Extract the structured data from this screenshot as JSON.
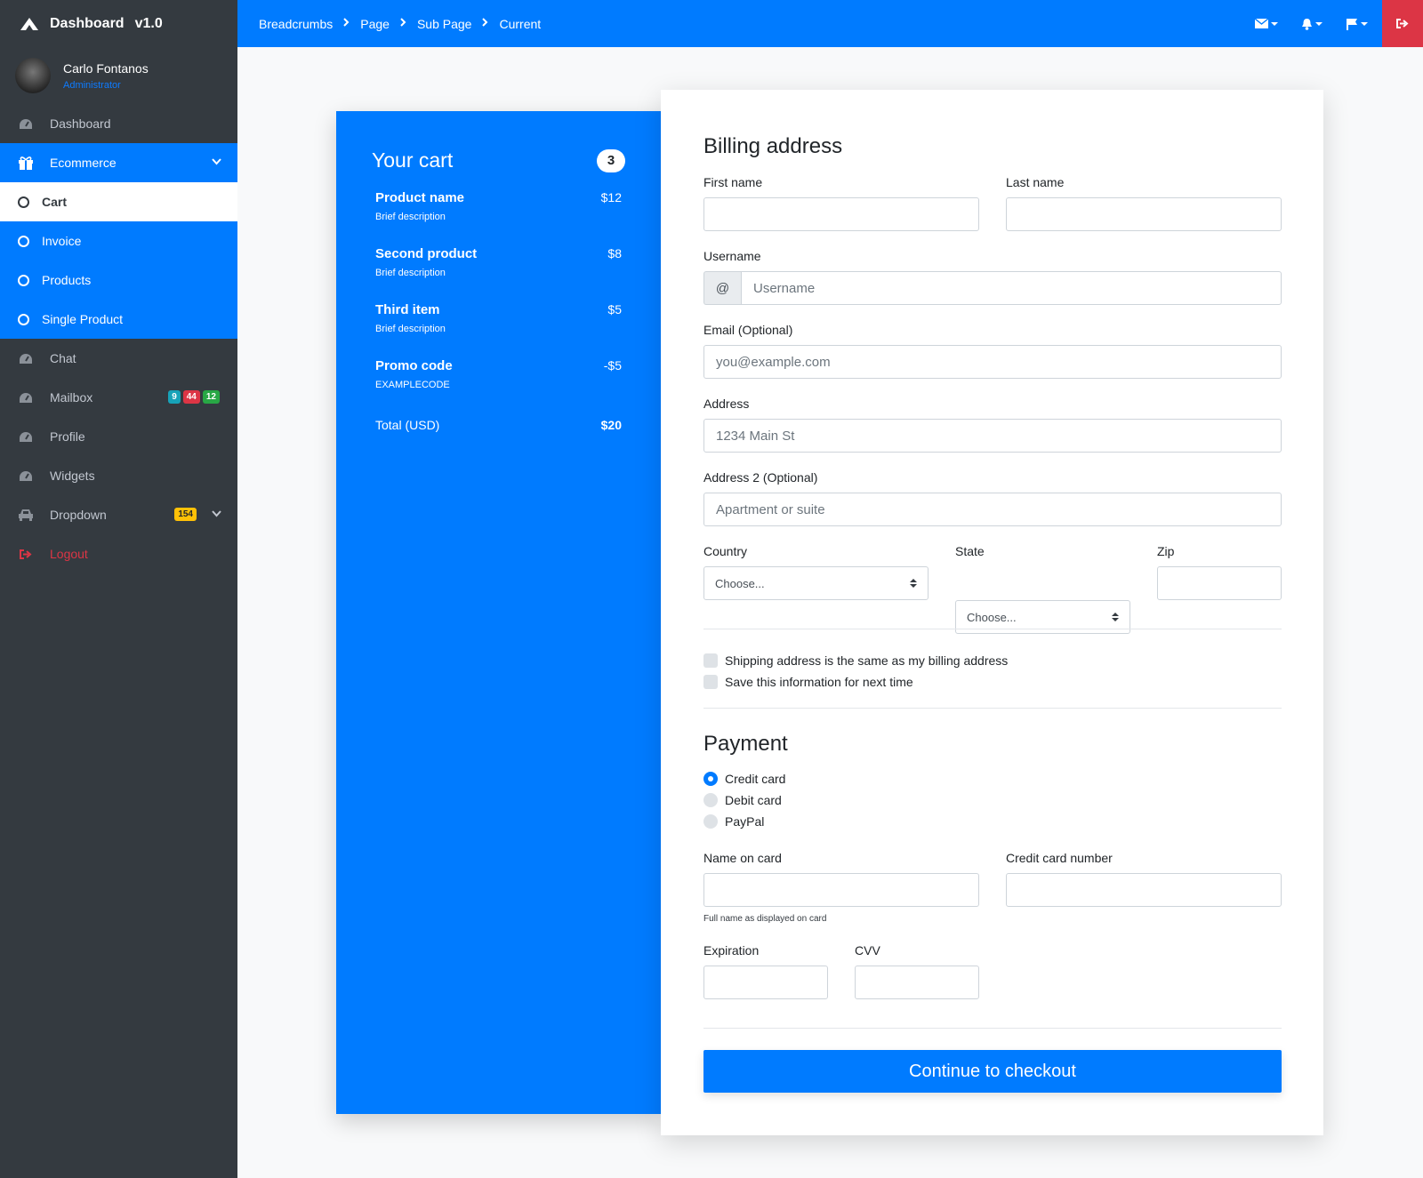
{
  "brand": {
    "title": "Dashboard",
    "version": "v1.0"
  },
  "user": {
    "name": "Carlo Fontanos",
    "role": "Administrator"
  },
  "sidebar": {
    "items": [
      {
        "label": "Dashboard",
        "icon": "dashboard-icon"
      },
      {
        "label": "Ecommerce",
        "icon": "gift-icon"
      },
      {
        "label": "Chat",
        "icon": "dashboard-icon"
      },
      {
        "label": "Mailbox",
        "icon": "dashboard-icon",
        "badges": [
          "9",
          "44",
          "12"
        ]
      },
      {
        "label": "Profile",
        "icon": "dashboard-icon"
      },
      {
        "label": "Widgets",
        "icon": "dashboard-icon"
      },
      {
        "label": "Dropdown",
        "icon": "car-icon",
        "badge": "154"
      },
      {
        "label": "Logout",
        "icon": "sign-out-icon"
      }
    ],
    "ecommerce_sub": [
      {
        "label": "Cart"
      },
      {
        "label": "Invoice"
      },
      {
        "label": "Products"
      },
      {
        "label": "Single Product"
      }
    ]
  },
  "breadcrumbs": [
    "Breadcrumbs",
    "Page",
    "Sub Page",
    "Current"
  ],
  "cart": {
    "title": "Your cart",
    "count": "3",
    "items": [
      {
        "name": "Product name",
        "desc": "Brief description",
        "price": "$12"
      },
      {
        "name": "Second product",
        "desc": "Brief description",
        "price": "$8"
      },
      {
        "name": "Third item",
        "desc": "Brief description",
        "price": "$5"
      },
      {
        "name": "Promo code",
        "desc": "EXAMPLECODE",
        "price": "-$5"
      }
    ],
    "total_label": "Total (USD)",
    "total_value": "$20"
  },
  "billing": {
    "title": "Billing address",
    "first_name_label": "First name",
    "last_name_label": "Last name",
    "username_label": "Username",
    "username_addon": "@",
    "username_placeholder": "Username",
    "email_label": "Email (Optional)",
    "email_placeholder": "you@example.com",
    "address_label": "Address",
    "address_placeholder": "1234 Main St",
    "address2_label": "Address 2 (Optional)",
    "address2_placeholder": "Apartment or suite",
    "country_label": "Country",
    "country_value": "Choose...",
    "state_label": "State",
    "state_value": "Choose...",
    "zip_label": "Zip",
    "same_address": "Shipping address is the same as my billing address",
    "save_info": "Save this information for next time"
  },
  "payment": {
    "title": "Payment",
    "options": [
      "Credit card",
      "Debit card",
      "PayPal"
    ],
    "name_on_card_label": "Name on card",
    "name_on_card_help": "Full name as displayed on card",
    "cc_number_label": "Credit card number",
    "expiration_label": "Expiration",
    "cvv_label": "CVV",
    "checkout_button": "Continue to checkout"
  },
  "colors": {
    "primary": "#007bff",
    "sidebar": "#343a40",
    "danger": "#dc3545"
  }
}
